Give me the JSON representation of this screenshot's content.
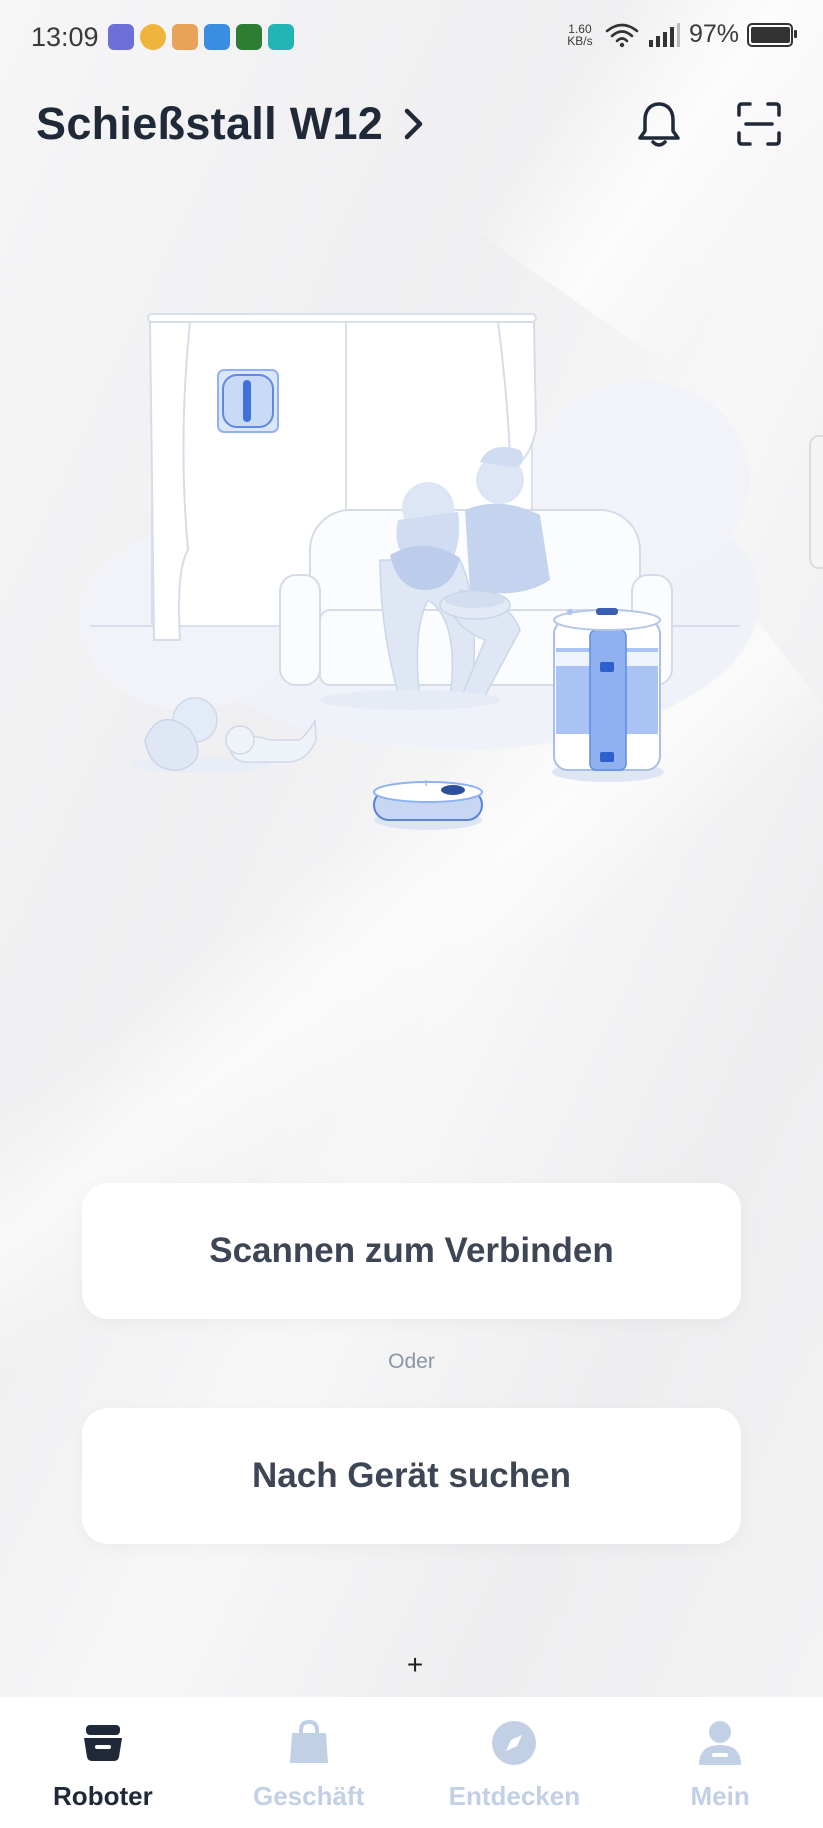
{
  "status_bar": {
    "time": "13:09",
    "speed_value": "1.60",
    "speed_unit": "KB/s",
    "battery_percent": "97%",
    "notification_icons": [
      "teams-icon",
      "browser-icon",
      "shopping-icon",
      "app-icon",
      "security-icon",
      "app-icon-2"
    ],
    "battery_level": 0.97
  },
  "header": {
    "title": "Schießstall W12"
  },
  "actions": {
    "scan_connect_label": "Scannen zum Verbinden",
    "or_label": "Oder",
    "search_device_label": "Nach Gerät suchen",
    "add_label": "+"
  },
  "bottom_nav": {
    "items": [
      {
        "label": "Roboter",
        "icon": "robot-icon",
        "active": true
      },
      {
        "label": "Geschäft",
        "icon": "shopping-bag-icon",
        "active": false
      },
      {
        "label": "Entdecken",
        "icon": "compass-icon",
        "active": false
      },
      {
        "label": "Mein",
        "icon": "user-icon",
        "active": false
      }
    ]
  },
  "colors": {
    "accent_blue": "#8fb3f2",
    "illustration_light": "#e6ecf6",
    "nav_inactive": "#c2d0e6",
    "text_dark": "#1f2937"
  }
}
